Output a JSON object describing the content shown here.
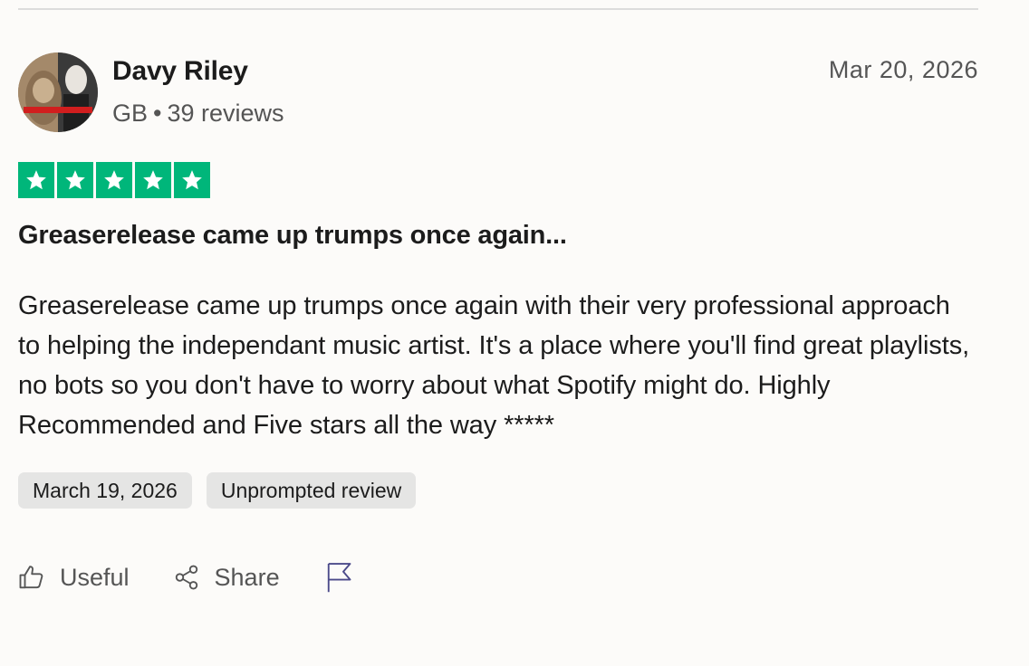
{
  "review": {
    "reviewer": {
      "name": "Davy Riley",
      "country": "GB",
      "separator": "•",
      "reviews_count": "39 reviews",
      "avatar_icon": "avatar-photo-icon"
    },
    "date": "Mar 20, 2026",
    "rating": 5,
    "rating_max": 5,
    "star_color": "#00b67a",
    "title": "Greaserelease came up trumps once again...",
    "body": "Greaserelease came up trumps once again with their very professional approach to helping the independant music artist. It's a place where you'll find great playlists, no bots so you don't have to worry about what Spotify might do. Highly Recommended and Five stars all the way *****",
    "tags": {
      "experience_date": "March 19, 2026",
      "review_type": "Unprompted review"
    },
    "actions": {
      "useful_label": "Useful",
      "useful_icon": "thumbs-up-icon",
      "share_label": "Share",
      "share_icon": "share-icon",
      "report_icon": "flag-icon"
    }
  }
}
